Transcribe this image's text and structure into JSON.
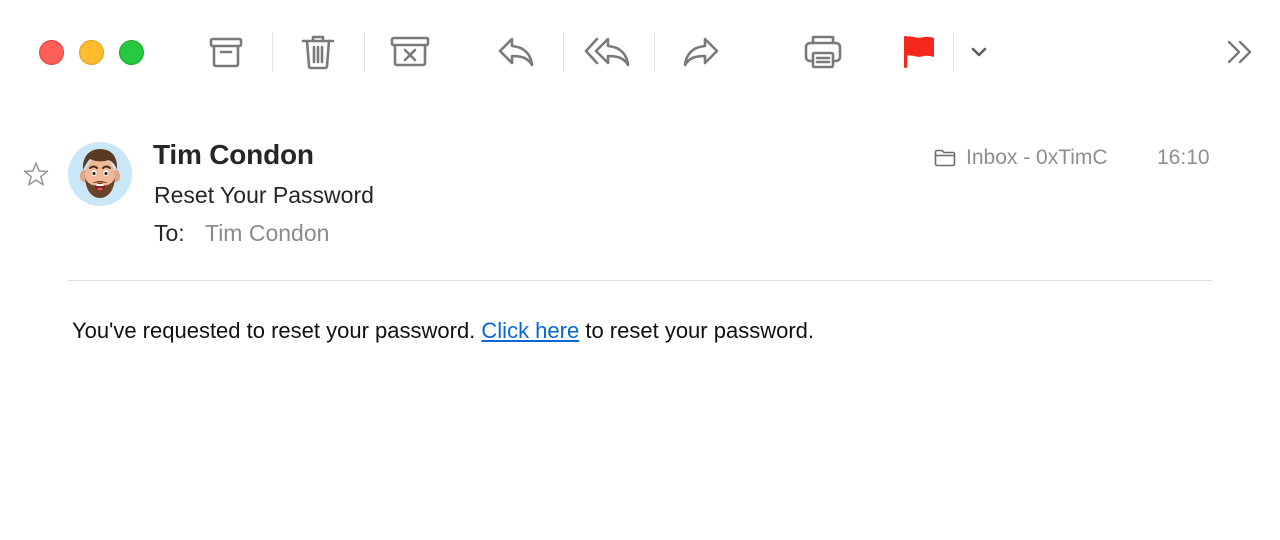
{
  "window": {
    "traffic_lights": [
      {
        "name": "close",
        "color": "#fe5f57"
      },
      {
        "name": "minimize",
        "color": "#febc2e"
      },
      {
        "name": "zoom",
        "color": "#28c840"
      }
    ]
  },
  "toolbar": {
    "icons": [
      "archive-icon",
      "trash-icon",
      "junk-icon",
      "reply-icon",
      "reply-all-icon",
      "forward-icon",
      "print-icon",
      "flag-icon",
      "chevron-down-icon",
      "overflow-chevrons-icon"
    ],
    "flag_color": "#f4271c",
    "icon_color": "#7a7a7a"
  },
  "message": {
    "sender": "Tim Condon",
    "subject": "Reset Your Password",
    "to_label": "To:",
    "to_value": "Tim Condon",
    "mailbox": "Inbox - 0xTimC",
    "time": "16:10",
    "body_before": "You've requested to reset your password. ",
    "body_link": "Click here",
    "body_after": " to reset your password.",
    "link_color": "#0a66d6"
  }
}
